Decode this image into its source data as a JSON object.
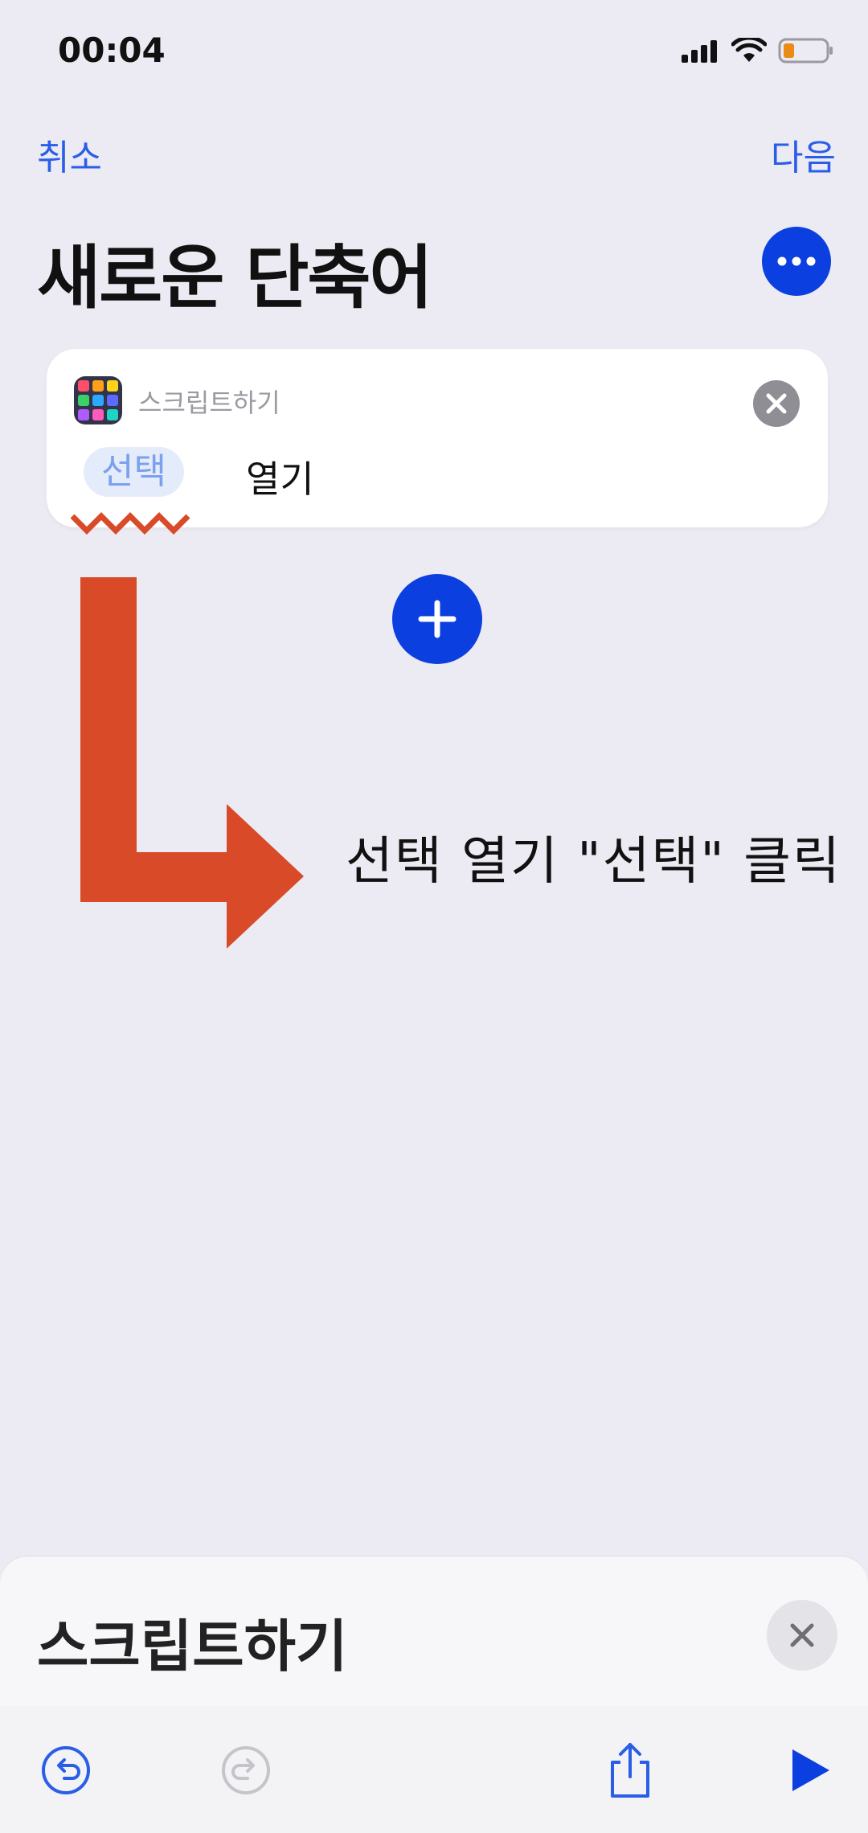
{
  "status_bar": {
    "time": "00:04"
  },
  "nav": {
    "cancel_label": "취소",
    "next_label": "다음"
  },
  "page": {
    "title": "새로운 단축어"
  },
  "action_card": {
    "app_label": "스크립트하기",
    "chip_label": "선택",
    "action_label": "열기"
  },
  "annotation": {
    "text": "선택 열기 \"선택\" 클릭"
  },
  "bottom_panel": {
    "title": "스크립트하기"
  },
  "colors": {
    "accent": "#0b3fe0",
    "link": "#2a5ee8",
    "annotation_arrow": "#d94a29"
  },
  "icons": [
    "signal-icon",
    "wifi-icon",
    "battery-icon",
    "more-icon",
    "app-grid-icon",
    "close-circle-icon",
    "plus-icon",
    "close-icon",
    "undo-icon",
    "redo-icon",
    "share-icon",
    "play-icon"
  ]
}
